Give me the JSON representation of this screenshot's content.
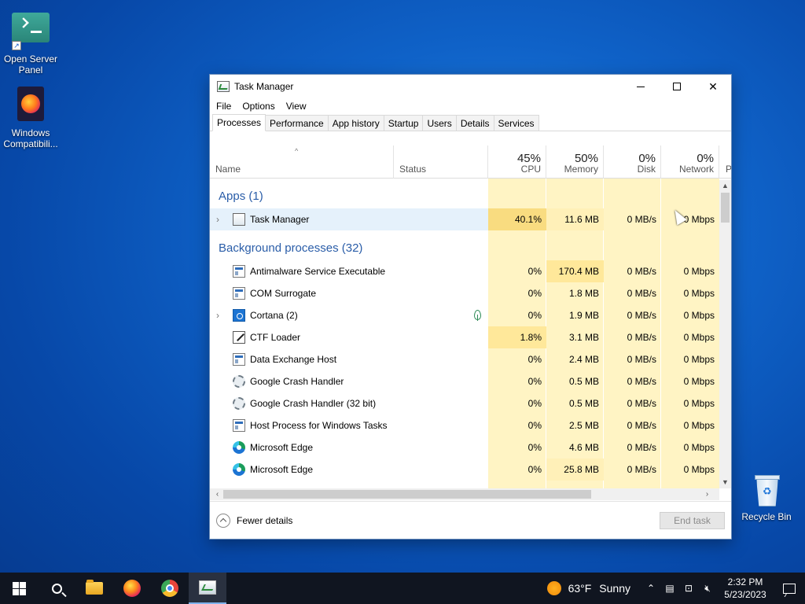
{
  "desktop": {
    "icons": [
      {
        "label_line1": "Open Server",
        "label_line2": "Panel",
        "icon": "terminal-icon"
      },
      {
        "label_line1": "Windows",
        "label_line2": "Compatibili...",
        "icon": "firefox-document-icon"
      },
      {
        "label_line1": "Recycle Bin",
        "label_line2": "",
        "icon": "recycle-bin-icon"
      }
    ]
  },
  "window": {
    "title": "Task Manager",
    "minimize_glyph": "",
    "close_glyph": "✕",
    "menu": [
      "File",
      "Options",
      "View"
    ],
    "tabs": [
      "Processes",
      "Performance",
      "App history",
      "Startup",
      "Users",
      "Details",
      "Services"
    ],
    "active_tab": "Processes",
    "columns": {
      "name": "Name",
      "status": "Status",
      "cpu": {
        "pct": "45%",
        "label": "CPU"
      },
      "memory": {
        "pct": "50%",
        "label": "Memory"
      },
      "disk": {
        "pct": "0%",
        "label": "Disk"
      },
      "network": {
        "pct": "0%",
        "label": "Network"
      },
      "power_partial": "P"
    },
    "sort_arrow": "^",
    "groups": {
      "apps": "Apps (1)",
      "background": "Background processes (32)"
    },
    "processes": [
      {
        "name": "Task Manager",
        "icon": "task-manager-icon",
        "expandable": true,
        "cpu": "40.1%",
        "memory": "11.6 MB",
        "disk": "0 MB/s",
        "network": "0 Mbps"
      },
      {
        "name": "Antimalware Service Executable",
        "icon": "service-icon",
        "expandable": false,
        "cpu": "0%",
        "memory": "170.4 MB",
        "disk": "0 MB/s",
        "network": "0 Mbps"
      },
      {
        "name": "COM Surrogate",
        "icon": "service-icon",
        "expandable": false,
        "cpu": "0%",
        "memory": "1.8 MB",
        "disk": "0 MB/s",
        "network": "0 Mbps"
      },
      {
        "name": "Cortana (2)",
        "icon": "cortana-icon",
        "expandable": true,
        "cpu": "0%",
        "memory": "1.9 MB",
        "disk": "0 MB/s",
        "network": "0 Mbps"
      },
      {
        "name": "CTF Loader",
        "icon": "ctf-loader-icon",
        "expandable": false,
        "cpu": "1.8%",
        "memory": "3.1 MB",
        "disk": "0 MB/s",
        "network": "0 Mbps"
      },
      {
        "name": "Data Exchange Host",
        "icon": "service-icon",
        "expandable": false,
        "cpu": "0%",
        "memory": "2.4 MB",
        "disk": "0 MB/s",
        "network": "0 Mbps"
      },
      {
        "name": "Google Crash Handler",
        "icon": "gear-icon",
        "expandable": false,
        "cpu": "0%",
        "memory": "0.5 MB",
        "disk": "0 MB/s",
        "network": "0 Mbps"
      },
      {
        "name": "Google Crash Handler (32 bit)",
        "icon": "gear-icon",
        "expandable": false,
        "cpu": "0%",
        "memory": "0.5 MB",
        "disk": "0 MB/s",
        "network": "0 Mbps"
      },
      {
        "name": "Host Process for Windows Tasks",
        "icon": "service-icon",
        "expandable": false,
        "cpu": "0%",
        "memory": "2.5 MB",
        "disk": "0 MB/s",
        "network": "0 Mbps"
      },
      {
        "name": "Microsoft Edge",
        "icon": "edge-icon",
        "expandable": false,
        "cpu": "0%",
        "memory": "4.6 MB",
        "disk": "0 MB/s",
        "network": "0 Mbps"
      },
      {
        "name": "Microsoft Edge",
        "icon": "edge-icon",
        "expandable": false,
        "cpu": "0%",
        "memory": "25.8 MB",
        "disk": "0 MB/s",
        "network": "0 Mbps"
      }
    ],
    "footer": {
      "fewer_details": "Fewer details",
      "end_task": "End task"
    }
  },
  "taskbar": {
    "weather": {
      "temp": "63°F",
      "condition": "Sunny"
    },
    "clock": {
      "time": "2:32 PM",
      "date": "5/23/2023"
    },
    "tray_icons": [
      "chevron-up-icon",
      "usb-drive-icon",
      "network-icon",
      "volume-muted-icon"
    ],
    "pinned": [
      "start-icon",
      "search-icon",
      "file-explorer-icon",
      "firefox-icon",
      "chrome-icon",
      "task-manager-icon"
    ]
  },
  "colors": {
    "heat_light": "#fff4c4",
    "heat_medium": "#ffe89a",
    "heat_high": "#f9dc80",
    "group_title": "#2a5da8",
    "selected_row": "#e5f1fb"
  }
}
